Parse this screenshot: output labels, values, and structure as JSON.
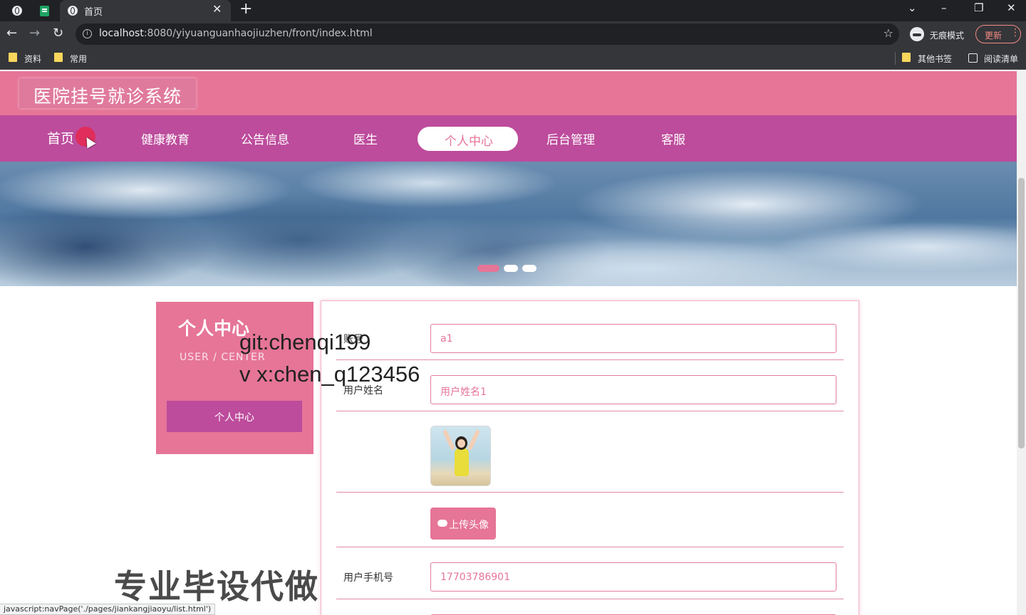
{
  "browser": {
    "tab_title": "首页",
    "url_host": "localhost",
    "url_rest": ":8080/yiyuanguanhaojiuzhen/front/index.html",
    "incognito_label": "无痕模式",
    "update_label": "更新",
    "bookmarks": [
      "资料",
      "常用"
    ],
    "other_bookmarks": "其他书签",
    "reading_list": "阅读清单",
    "status_text": "javascript:navPage('./pages/jiankangjiaoyu/list.html')"
  },
  "header": {
    "title": "医院挂号就诊系统"
  },
  "nav": {
    "items": [
      "首页",
      "健康教育",
      "公告信息",
      "医生",
      "个人中心",
      "后台管理",
      "客服"
    ],
    "active": "个人中心"
  },
  "banner": {
    "dots": 3,
    "active_dot": 0
  },
  "side": {
    "title": "个人中心",
    "subtitle": "USER / CENTER",
    "button": "个人中心"
  },
  "form": {
    "account_label": "账号",
    "account_value": "a1",
    "name_label": "用户姓名",
    "name_value": "用户姓名1",
    "upload_label": "上传头像",
    "phone_label": "用户手机号",
    "phone_value": "17703786901"
  },
  "watermark": {
    "line1": "git:chenqi199",
    "line2": "v x:chen_q123456",
    "line3": "专业毕设代做"
  },
  "colors": {
    "primary": "#e67598",
    "nav": "#bd4c9c"
  }
}
